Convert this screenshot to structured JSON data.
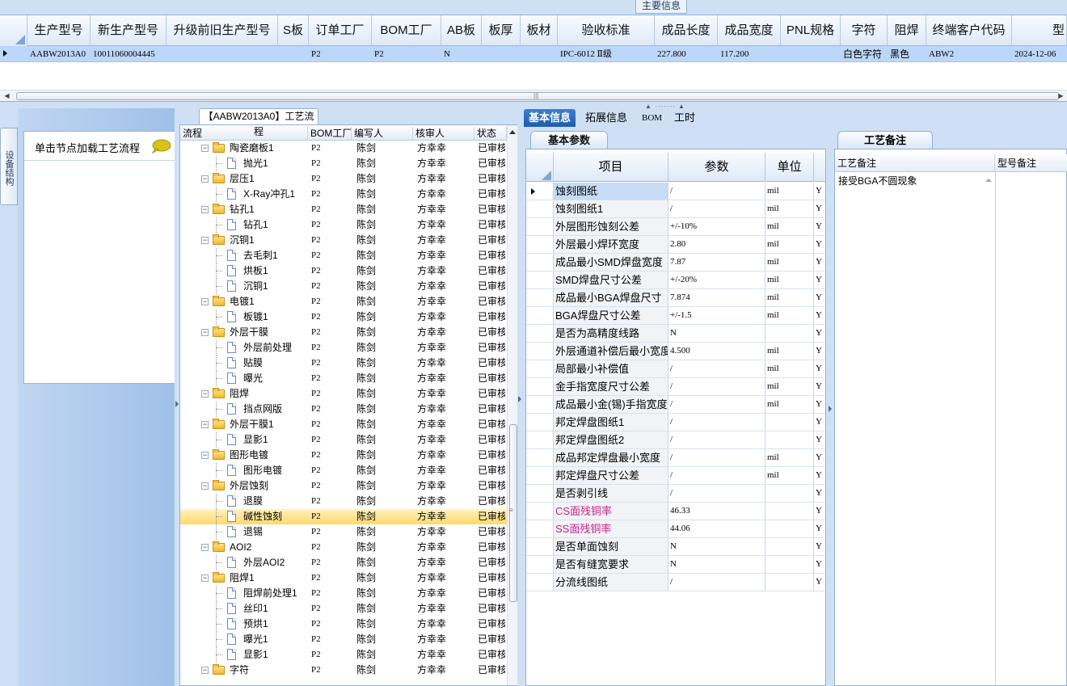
{
  "main_info": {
    "title": "主要信息",
    "columns": [
      "生产型号",
      "新生产型号",
      "升级前旧生产型号",
      "S板",
      "订单工厂",
      "BOM工厂",
      "AB板",
      "板厚",
      "板材",
      "验收标准",
      "成品长度",
      "成品宽度",
      "PNL规格",
      "字符",
      "阻焊",
      "终端客户代码",
      "型"
    ],
    "row": [
      "AABW2013A0",
      "10011060004445",
      "",
      "",
      "P2",
      "P2",
      "N",
      "",
      "",
      "IPC-6012 Ⅱ级",
      "227.800",
      "117.200",
      "",
      "白色字符",
      "黑色",
      "ABW2",
      "2024-12-06"
    ]
  },
  "left_panel": {
    "vertical_tab": "设备结构",
    "hint": "单击节点加载工艺流程",
    "hint_icon": "speech-bubble-icon"
  },
  "flow": {
    "title": "【AABW2013A0】工艺流程",
    "columns": [
      "流程",
      "BOM工厂",
      "编写人",
      "核审人",
      "状态"
    ],
    "rows": [
      {
        "name": "陶瓷磨板1",
        "type": "folder",
        "level": 0,
        "bom": "P2",
        "author": "陈剑",
        "reviewer": "方幸幸",
        "status": "已审核"
      },
      {
        "name": "抛光1",
        "type": "file",
        "level": 1,
        "bom": "P2",
        "author": "陈剑",
        "reviewer": "方幸幸",
        "status": "已审核"
      },
      {
        "name": "层压1",
        "type": "folder",
        "level": 0,
        "bom": "P2",
        "author": "陈剑",
        "reviewer": "方幸幸",
        "status": "已审核"
      },
      {
        "name": "X-Ray冲孔1",
        "type": "file",
        "level": 1,
        "bom": "P2",
        "author": "陈剑",
        "reviewer": "方幸幸",
        "status": "已审核"
      },
      {
        "name": "钻孔1",
        "type": "folder",
        "level": 0,
        "bom": "P2",
        "author": "陈剑",
        "reviewer": "方幸幸",
        "status": "已审核"
      },
      {
        "name": "钻孔1",
        "type": "file",
        "level": 1,
        "bom": "P2",
        "author": "陈剑",
        "reviewer": "方幸幸",
        "status": "已审核"
      },
      {
        "name": "沉铜1",
        "type": "folder",
        "level": 0,
        "bom": "P2",
        "author": "陈剑",
        "reviewer": "方幸幸",
        "status": "已审核"
      },
      {
        "name": "去毛刺1",
        "type": "file",
        "level": 1,
        "bom": "P2",
        "author": "陈剑",
        "reviewer": "方幸幸",
        "status": "已审核"
      },
      {
        "name": "烘板1",
        "type": "file",
        "level": 1,
        "bom": "P2",
        "author": "陈剑",
        "reviewer": "方幸幸",
        "status": "已审核"
      },
      {
        "name": "沉铜1",
        "type": "file",
        "level": 1,
        "bom": "P2",
        "author": "陈剑",
        "reviewer": "方幸幸",
        "status": "已审核"
      },
      {
        "name": "电镀1",
        "type": "folder",
        "level": 0,
        "bom": "P2",
        "author": "陈剑",
        "reviewer": "方幸幸",
        "status": "已审核"
      },
      {
        "name": "板镀1",
        "type": "file",
        "level": 1,
        "bom": "P2",
        "author": "陈剑",
        "reviewer": "方幸幸",
        "status": "已审核"
      },
      {
        "name": "外层干膜",
        "type": "folder",
        "level": 0,
        "bom": "P2",
        "author": "陈剑",
        "reviewer": "方幸幸",
        "status": "已审核"
      },
      {
        "name": "外层前处理",
        "type": "file",
        "level": 1,
        "bom": "P2",
        "author": "陈剑",
        "reviewer": "方幸幸",
        "status": "已审核"
      },
      {
        "name": "贴膜",
        "type": "file",
        "level": 1,
        "bom": "P2",
        "author": "陈剑",
        "reviewer": "方幸幸",
        "status": "已审核"
      },
      {
        "name": "曝光",
        "type": "file",
        "level": 1,
        "bom": "P2",
        "author": "陈剑",
        "reviewer": "方幸幸",
        "status": "已审核"
      },
      {
        "name": "阻焊",
        "type": "folder",
        "level": 0,
        "bom": "P2",
        "author": "陈剑",
        "reviewer": "方幸幸",
        "status": "已审核"
      },
      {
        "name": "挡点网版",
        "type": "file",
        "level": 1,
        "bom": "P2",
        "author": "陈剑",
        "reviewer": "方幸幸",
        "status": "已审核"
      },
      {
        "name": "外层干膜1",
        "type": "folder",
        "level": 0,
        "bom": "P2",
        "author": "陈剑",
        "reviewer": "方幸幸",
        "status": "已审核"
      },
      {
        "name": "显影1",
        "type": "file",
        "level": 1,
        "bom": "P2",
        "author": "陈剑",
        "reviewer": "方幸幸",
        "status": "已审核"
      },
      {
        "name": "图形电镀",
        "type": "folder",
        "level": 0,
        "bom": "P2",
        "author": "陈剑",
        "reviewer": "方幸幸",
        "status": "已审核"
      },
      {
        "name": "图形电镀",
        "type": "file",
        "level": 1,
        "bom": "P2",
        "author": "陈剑",
        "reviewer": "方幸幸",
        "status": "已审核"
      },
      {
        "name": "外层蚀刻",
        "type": "folder",
        "level": 0,
        "bom": "P2",
        "author": "陈剑",
        "reviewer": "方幸幸",
        "status": "已审核"
      },
      {
        "name": "退膜",
        "type": "file",
        "level": 1,
        "bom": "P2",
        "author": "陈剑",
        "reviewer": "方幸幸",
        "status": "已审核"
      },
      {
        "name": "碱性蚀刻",
        "type": "file",
        "level": 1,
        "bom": "P2",
        "author": "陈剑",
        "reviewer": "方幸幸",
        "status": "已审核",
        "selected": true
      },
      {
        "name": "退锡",
        "type": "file",
        "level": 1,
        "bom": "P2",
        "author": "陈剑",
        "reviewer": "方幸幸",
        "status": "已审核"
      },
      {
        "name": "AOI2",
        "type": "folder",
        "level": 0,
        "bom": "P2",
        "author": "陈剑",
        "reviewer": "方幸幸",
        "status": "已审核"
      },
      {
        "name": "外层AOI2",
        "type": "file",
        "level": 1,
        "bom": "P2",
        "author": "陈剑",
        "reviewer": "方幸幸",
        "status": "已审核"
      },
      {
        "name": "阻焊1",
        "type": "folder",
        "level": 0,
        "bom": "P2",
        "author": "陈剑",
        "reviewer": "方幸幸",
        "status": "已审核"
      },
      {
        "name": "阻焊前处理1",
        "type": "file",
        "level": 1,
        "bom": "P2",
        "author": "陈剑",
        "reviewer": "方幸幸",
        "status": "已审核"
      },
      {
        "name": "丝印1",
        "type": "file",
        "level": 1,
        "bom": "P2",
        "author": "陈剑",
        "reviewer": "方幸幸",
        "status": "已审核"
      },
      {
        "name": "预烘1",
        "type": "file",
        "level": 1,
        "bom": "P2",
        "author": "陈剑",
        "reviewer": "方幸幸",
        "status": "已审核"
      },
      {
        "name": "曝光1",
        "type": "file",
        "level": 1,
        "bom": "P2",
        "author": "陈剑",
        "reviewer": "方幸幸",
        "status": "已审核"
      },
      {
        "name": "显影1",
        "type": "file",
        "level": 1,
        "bom": "P2",
        "author": "陈剑",
        "reviewer": "方幸幸",
        "status": "已审核"
      },
      {
        "name": "字符",
        "type": "folder",
        "level": 0,
        "bom": "P2",
        "author": "陈剑",
        "reviewer": "方幸幸",
        "status": "已审核"
      }
    ]
  },
  "tabs": [
    "基本信息",
    "拓展信息",
    "BOM",
    "工时"
  ],
  "basic": {
    "subtab": "基本参数",
    "columns": [
      "项目",
      "参数",
      "单位"
    ],
    "rows": [
      {
        "item": "蚀刻图纸",
        "param": "/",
        "unit": "mil",
        "flag": "Y",
        "current": true
      },
      {
        "item": "蚀刻图纸1",
        "param": "/",
        "unit": "mil",
        "flag": "Y"
      },
      {
        "item": "外层图形蚀刻公差",
        "param": "+/-10%",
        "unit": "mil",
        "flag": "Y"
      },
      {
        "item": "外层最小焊环宽度",
        "param": "2.80",
        "unit": "mil",
        "flag": "Y"
      },
      {
        "item": "成品最小SMD焊盘宽度",
        "param": "7.87",
        "unit": "mil",
        "flag": "Y"
      },
      {
        "item": "SMD焊盘尺寸公差",
        "param": "+/-20%",
        "unit": "mil",
        "flag": "Y"
      },
      {
        "item": "成品最小BGA焊盘尺寸",
        "param": "7.874",
        "unit": "mil",
        "flag": "Y"
      },
      {
        "item": "BGA焊盘尺寸公差",
        "param": "+/-1.5",
        "unit": "mil",
        "flag": "Y"
      },
      {
        "item": "是否为高精度线路",
        "param": "N",
        "unit": "",
        "flag": "Y"
      },
      {
        "item": "外层通道补偿后最小宽度",
        "param": "4.500",
        "unit": "mil",
        "flag": "Y"
      },
      {
        "item": "局部最小补偿值",
        "param": "/",
        "unit": "mil",
        "flag": "Y"
      },
      {
        "item": "金手指宽度尺寸公差",
        "param": "/",
        "unit": "mil",
        "flag": "Y"
      },
      {
        "item": "成品最小金(锡)手指宽度",
        "param": "/",
        "unit": "mil",
        "flag": "Y"
      },
      {
        "item": "邦定焊盘图纸1",
        "param": "/",
        "unit": "",
        "flag": "Y"
      },
      {
        "item": "邦定焊盘图纸2",
        "param": "/",
        "unit": "",
        "flag": "Y"
      },
      {
        "item": "成品邦定焊盘最小宽度",
        "param": "/",
        "unit": "mil",
        "flag": "Y"
      },
      {
        "item": "邦定焊盘尺寸公差",
        "param": "/",
        "unit": "mil",
        "flag": "Y"
      },
      {
        "item": "是否剥引线",
        "param": "/",
        "unit": "",
        "flag": "Y"
      },
      {
        "item": "CS面残铜率",
        "param": "46.33",
        "unit": "",
        "flag": "Y",
        "pink": true
      },
      {
        "item": "SS面残铜率",
        "param": "44.06",
        "unit": "",
        "flag": "Y",
        "pink": true
      },
      {
        "item": "是否单面蚀刻",
        "param": "N",
        "unit": "",
        "flag": "Y"
      },
      {
        "item": "是否有缝宽要求",
        "param": "N",
        "unit": "",
        "flag": "Y"
      },
      {
        "item": "分流线图纸",
        "param": "/",
        "unit": "",
        "flag": "Y"
      }
    ]
  },
  "remarks": {
    "tab": "工艺备注",
    "columns": [
      "工艺备注",
      "型号备注"
    ],
    "text": "接受BGA不圆现象"
  },
  "colors": {
    "selected_row": "#bcd7f7",
    "active_tab": "#1f5cae",
    "highlight": "#ffd86a",
    "pink_text": "#c0268a"
  }
}
